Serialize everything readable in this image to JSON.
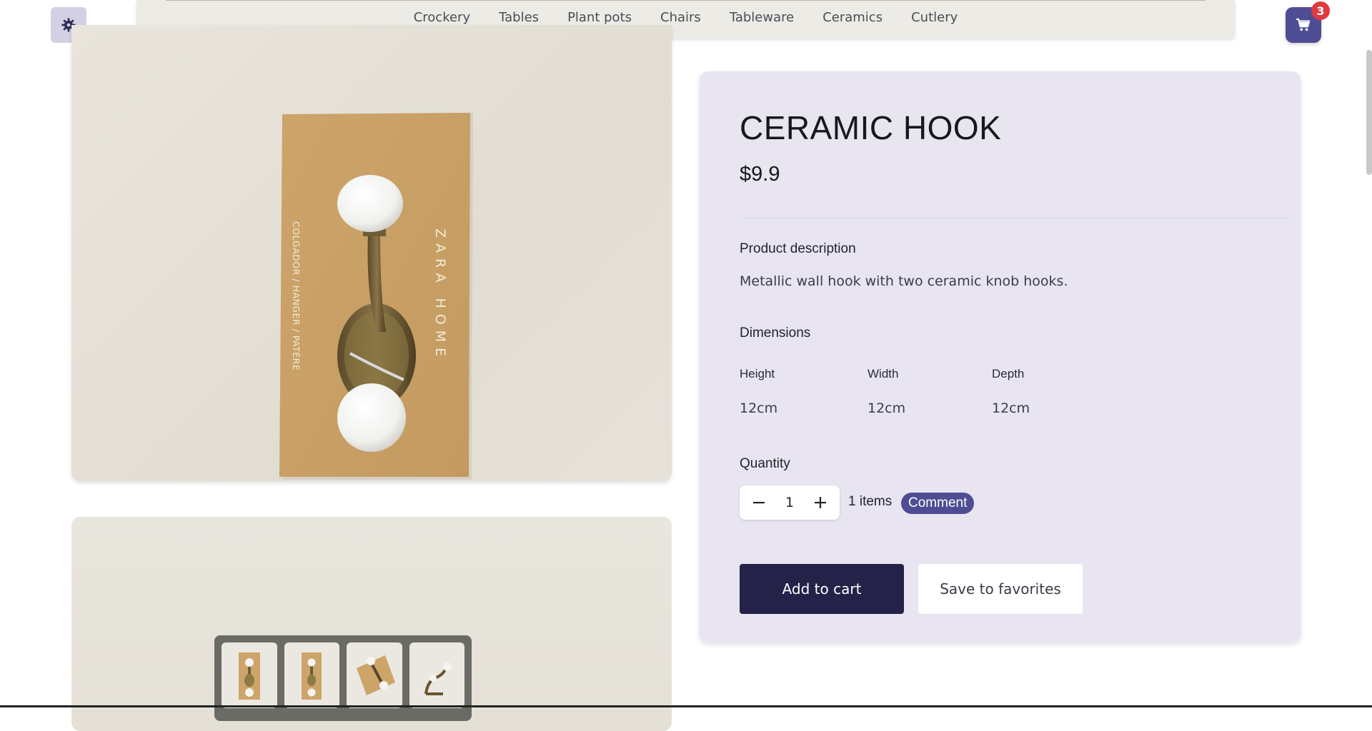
{
  "nav": {
    "items": [
      "Crockery",
      "Tables",
      "Plant pots",
      "Chairs",
      "Tableware",
      "Ceramics",
      "Cutlery"
    ]
  },
  "theme_toggle": {
    "icon": "gear-icon"
  },
  "cart": {
    "icon": "cart-icon",
    "count": "3",
    "color": "#4e4d94",
    "badge_color": "#e0393d"
  },
  "product": {
    "title": "CERAMIC HOOK",
    "price": "$9.9",
    "box_text_side": "COLGADOR / HANGER / PATÈRE",
    "box_text_brand": "ZARA HOME",
    "description_heading": "Product description",
    "description": "Metallic wall hook with two ceramic knob hooks.",
    "dimensions_heading": "Dimensions",
    "dimensions": [
      {
        "label": "Height",
        "value": "12cm"
      },
      {
        "label": "Width",
        "value": "12cm"
      },
      {
        "label": "Depth",
        "value": "12cm"
      }
    ],
    "quantity_heading": "Quantity",
    "quantity": "1",
    "items_text": "1 items",
    "comment_label": "Comment",
    "add_to_cart_label": "Add to cart",
    "save_favorites_label": "Save to favorites"
  },
  "thumbnails": [
    {
      "name": "thumbnail-1"
    },
    {
      "name": "thumbnail-2"
    },
    {
      "name": "thumbnail-3"
    },
    {
      "name": "thumbnail-4"
    }
  ],
  "colors": {
    "accent": "#4e4d94",
    "primary_button": "#25224a",
    "card_bg": "#e8e5f1"
  }
}
